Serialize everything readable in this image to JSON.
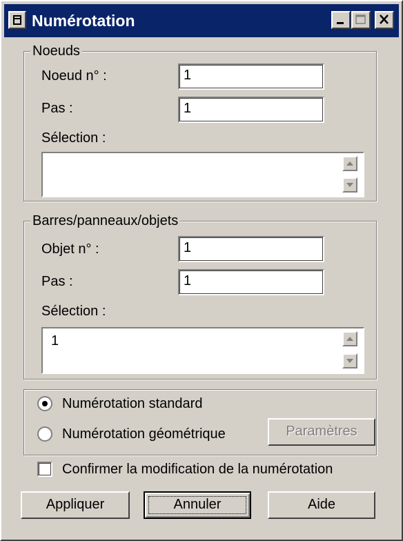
{
  "window": {
    "title": "Numérotation",
    "icon": "app-window-icon",
    "title_bar_color": "#0a246a",
    "face_color": "#d4d0c8"
  },
  "nodes": {
    "legend": "Noeuds",
    "node_no_label": "Noeud n° :",
    "node_no_value": "1",
    "step_label": "Pas :",
    "step_value": "1",
    "selection_label": "Sélection :",
    "selection_value": ""
  },
  "objects": {
    "legend": "Barres/panneaux/objets",
    "object_no_label": "Objet n° :",
    "object_no_value": "1",
    "step_label": "Pas :",
    "step_value": "1",
    "selection_label": "Sélection :",
    "selection_value": "1"
  },
  "numbering_mode": {
    "standard_label": "Numérotation standard",
    "geometric_label": "Numérotation géométrique",
    "selected": "standard",
    "parameters_button": "Paramètres"
  },
  "confirm": {
    "label": "Confirmer la modification de la numérotation",
    "checked": false
  },
  "buttons": {
    "apply": "Appliquer",
    "cancel": "Annuler",
    "help": "Aide"
  }
}
